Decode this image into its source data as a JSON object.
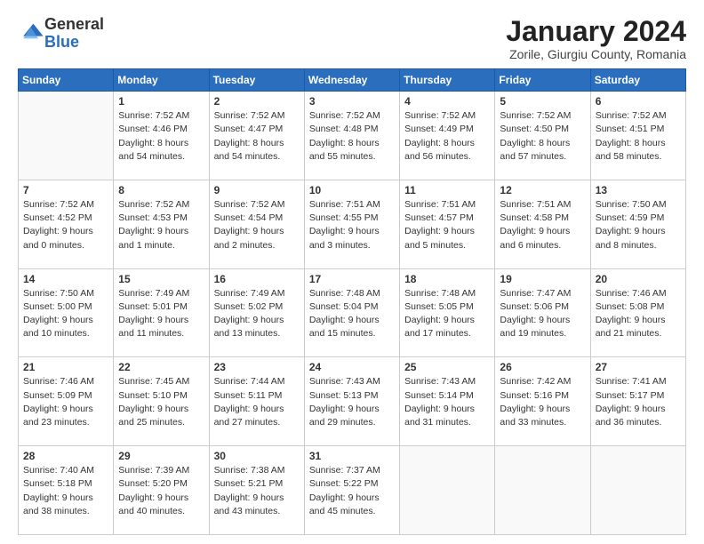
{
  "header": {
    "logo_general": "General",
    "logo_blue": "Blue",
    "month_title": "January 2024",
    "location": "Zorile, Giurgiu County, Romania"
  },
  "weekdays": [
    "Sunday",
    "Monday",
    "Tuesday",
    "Wednesday",
    "Thursday",
    "Friday",
    "Saturday"
  ],
  "weeks": [
    [
      {
        "day": "",
        "sunrise": "",
        "sunset": "",
        "daylight": ""
      },
      {
        "day": "1",
        "sunrise": "Sunrise: 7:52 AM",
        "sunset": "Sunset: 4:46 PM",
        "daylight": "Daylight: 8 hours and 54 minutes."
      },
      {
        "day": "2",
        "sunrise": "Sunrise: 7:52 AM",
        "sunset": "Sunset: 4:47 PM",
        "daylight": "Daylight: 8 hours and 54 minutes."
      },
      {
        "day": "3",
        "sunrise": "Sunrise: 7:52 AM",
        "sunset": "Sunset: 4:48 PM",
        "daylight": "Daylight: 8 hours and 55 minutes."
      },
      {
        "day": "4",
        "sunrise": "Sunrise: 7:52 AM",
        "sunset": "Sunset: 4:49 PM",
        "daylight": "Daylight: 8 hours and 56 minutes."
      },
      {
        "day": "5",
        "sunrise": "Sunrise: 7:52 AM",
        "sunset": "Sunset: 4:50 PM",
        "daylight": "Daylight: 8 hours and 57 minutes."
      },
      {
        "day": "6",
        "sunrise": "Sunrise: 7:52 AM",
        "sunset": "Sunset: 4:51 PM",
        "daylight": "Daylight: 8 hours and 58 minutes."
      }
    ],
    [
      {
        "day": "7",
        "sunrise": "Sunrise: 7:52 AM",
        "sunset": "Sunset: 4:52 PM",
        "daylight": "Daylight: 9 hours and 0 minutes."
      },
      {
        "day": "8",
        "sunrise": "Sunrise: 7:52 AM",
        "sunset": "Sunset: 4:53 PM",
        "daylight": "Daylight: 9 hours and 1 minute."
      },
      {
        "day": "9",
        "sunrise": "Sunrise: 7:52 AM",
        "sunset": "Sunset: 4:54 PM",
        "daylight": "Daylight: 9 hours and 2 minutes."
      },
      {
        "day": "10",
        "sunrise": "Sunrise: 7:51 AM",
        "sunset": "Sunset: 4:55 PM",
        "daylight": "Daylight: 9 hours and 3 minutes."
      },
      {
        "day": "11",
        "sunrise": "Sunrise: 7:51 AM",
        "sunset": "Sunset: 4:57 PM",
        "daylight": "Daylight: 9 hours and 5 minutes."
      },
      {
        "day": "12",
        "sunrise": "Sunrise: 7:51 AM",
        "sunset": "Sunset: 4:58 PM",
        "daylight": "Daylight: 9 hours and 6 minutes."
      },
      {
        "day": "13",
        "sunrise": "Sunrise: 7:50 AM",
        "sunset": "Sunset: 4:59 PM",
        "daylight": "Daylight: 9 hours and 8 minutes."
      }
    ],
    [
      {
        "day": "14",
        "sunrise": "Sunrise: 7:50 AM",
        "sunset": "Sunset: 5:00 PM",
        "daylight": "Daylight: 9 hours and 10 minutes."
      },
      {
        "day": "15",
        "sunrise": "Sunrise: 7:49 AM",
        "sunset": "Sunset: 5:01 PM",
        "daylight": "Daylight: 9 hours and 11 minutes."
      },
      {
        "day": "16",
        "sunrise": "Sunrise: 7:49 AM",
        "sunset": "Sunset: 5:02 PM",
        "daylight": "Daylight: 9 hours and 13 minutes."
      },
      {
        "day": "17",
        "sunrise": "Sunrise: 7:48 AM",
        "sunset": "Sunset: 5:04 PM",
        "daylight": "Daylight: 9 hours and 15 minutes."
      },
      {
        "day": "18",
        "sunrise": "Sunrise: 7:48 AM",
        "sunset": "Sunset: 5:05 PM",
        "daylight": "Daylight: 9 hours and 17 minutes."
      },
      {
        "day": "19",
        "sunrise": "Sunrise: 7:47 AM",
        "sunset": "Sunset: 5:06 PM",
        "daylight": "Daylight: 9 hours and 19 minutes."
      },
      {
        "day": "20",
        "sunrise": "Sunrise: 7:46 AM",
        "sunset": "Sunset: 5:08 PM",
        "daylight": "Daylight: 9 hours and 21 minutes."
      }
    ],
    [
      {
        "day": "21",
        "sunrise": "Sunrise: 7:46 AM",
        "sunset": "Sunset: 5:09 PM",
        "daylight": "Daylight: 9 hours and 23 minutes."
      },
      {
        "day": "22",
        "sunrise": "Sunrise: 7:45 AM",
        "sunset": "Sunset: 5:10 PM",
        "daylight": "Daylight: 9 hours and 25 minutes."
      },
      {
        "day": "23",
        "sunrise": "Sunrise: 7:44 AM",
        "sunset": "Sunset: 5:11 PM",
        "daylight": "Daylight: 9 hours and 27 minutes."
      },
      {
        "day": "24",
        "sunrise": "Sunrise: 7:43 AM",
        "sunset": "Sunset: 5:13 PM",
        "daylight": "Daylight: 9 hours and 29 minutes."
      },
      {
        "day": "25",
        "sunrise": "Sunrise: 7:43 AM",
        "sunset": "Sunset: 5:14 PM",
        "daylight": "Daylight: 9 hours and 31 minutes."
      },
      {
        "day": "26",
        "sunrise": "Sunrise: 7:42 AM",
        "sunset": "Sunset: 5:16 PM",
        "daylight": "Daylight: 9 hours and 33 minutes."
      },
      {
        "day": "27",
        "sunrise": "Sunrise: 7:41 AM",
        "sunset": "Sunset: 5:17 PM",
        "daylight": "Daylight: 9 hours and 36 minutes."
      }
    ],
    [
      {
        "day": "28",
        "sunrise": "Sunrise: 7:40 AM",
        "sunset": "Sunset: 5:18 PM",
        "daylight": "Daylight: 9 hours and 38 minutes."
      },
      {
        "day": "29",
        "sunrise": "Sunrise: 7:39 AM",
        "sunset": "Sunset: 5:20 PM",
        "daylight": "Daylight: 9 hours and 40 minutes."
      },
      {
        "day": "30",
        "sunrise": "Sunrise: 7:38 AM",
        "sunset": "Sunset: 5:21 PM",
        "daylight": "Daylight: 9 hours and 43 minutes."
      },
      {
        "day": "31",
        "sunrise": "Sunrise: 7:37 AM",
        "sunset": "Sunset: 5:22 PM",
        "daylight": "Daylight: 9 hours and 45 minutes."
      },
      {
        "day": "",
        "sunrise": "",
        "sunset": "",
        "daylight": ""
      },
      {
        "day": "",
        "sunrise": "",
        "sunset": "",
        "daylight": ""
      },
      {
        "day": "",
        "sunrise": "",
        "sunset": "",
        "daylight": ""
      }
    ]
  ]
}
